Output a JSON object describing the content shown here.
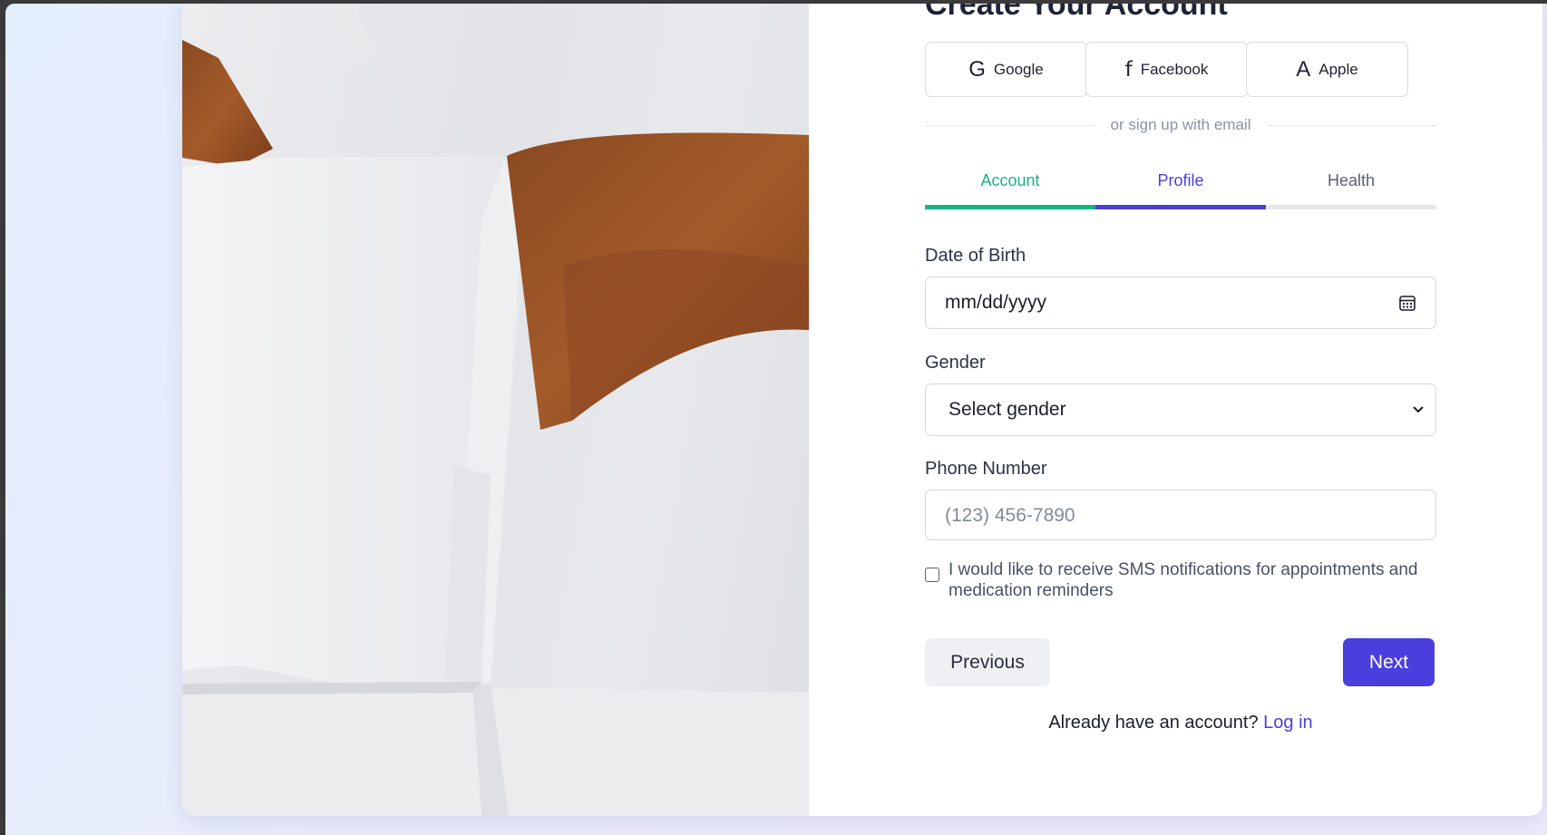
{
  "form": {
    "title": "Create Your Account",
    "social": [
      {
        "label": "Google",
        "glyph": "G",
        "icon": "google-icon"
      },
      {
        "label": "Facebook",
        "glyph": "f",
        "icon": "facebook-icon"
      },
      {
        "label": "Apple",
        "glyph": "A",
        "icon": "apple-icon"
      }
    ],
    "divider_text": "or sign up with email",
    "tabs": [
      {
        "label": "Account",
        "state": "completed"
      },
      {
        "label": "Profile",
        "state": "active"
      },
      {
        "label": "Health",
        "state": "pending"
      }
    ],
    "dob": {
      "label": "Date of Birth",
      "value": "mm/dd/yyyy",
      "icon": "calendar-icon"
    },
    "gender": {
      "label": "Gender",
      "selected": "Select gender",
      "icon": "chevron-down-icon"
    },
    "phone": {
      "label": "Phone Number",
      "placeholder": "(123) 456-7890"
    },
    "sms_optin": {
      "label": "I would like to receive SMS notifications for appointments and medication reminders",
      "checked": false
    },
    "prev_label": "Previous",
    "next_label": "Next",
    "login_prompt": "Already have an account?",
    "login_link": "Log in"
  },
  "colors": {
    "completed": "#16b57f",
    "active": "#4c3fd6",
    "pending_text": "#5a6172",
    "pending_bar": "#e5e7eb",
    "primary_button": "#4a3fdc"
  }
}
